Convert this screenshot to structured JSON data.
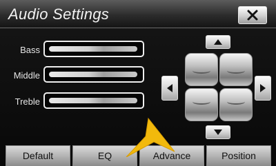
{
  "header": {
    "title": "Audio Settings"
  },
  "icons": {
    "close": "close-icon",
    "up": "arrow-up-icon",
    "down": "arrow-down-icon",
    "left": "arrow-left-icon",
    "right": "arrow-right-icon",
    "pointer": "pointer-arrow-icon"
  },
  "sliders": [
    {
      "label": "Bass"
    },
    {
      "label": "Middle"
    },
    {
      "label": "Treble"
    }
  ],
  "tabs": [
    {
      "label": "Default"
    },
    {
      "label": "EQ"
    },
    {
      "label": "Advance"
    },
    {
      "label": "Position"
    }
  ],
  "colors": {
    "accent": "#f2b90c"
  }
}
